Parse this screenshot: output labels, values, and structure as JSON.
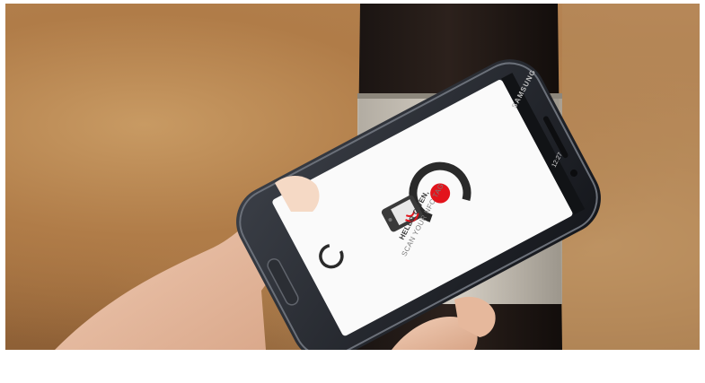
{
  "scene": {
    "description_labels": {
      "phone_brand": "SAMSUNG",
      "status_time": "12:27"
    }
  },
  "app_screen": {
    "greeting": "HELLO GWEN,",
    "instruction": "SCAN YOUR NFC TAG",
    "logo_icon": "nfc-scanner-logo-icon",
    "loading_icon": "loading-ring-icon",
    "accent_color": "#e3141c",
    "background_color": "#ffffff"
  }
}
